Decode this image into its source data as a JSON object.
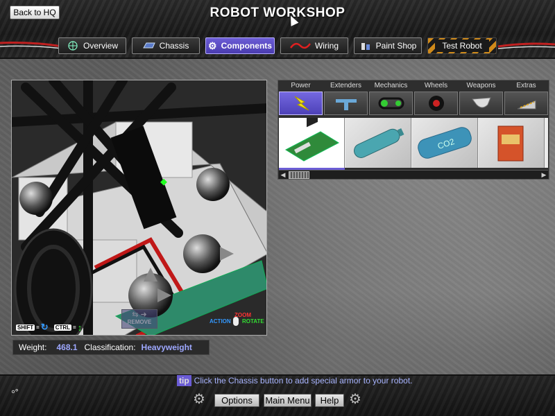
{
  "header": {
    "back_label": "Back to HQ",
    "title": "ROBOT WORKSHOP"
  },
  "tabs": [
    {
      "label": "Overview",
      "icon": "globe-icon"
    },
    {
      "label": "Chassis",
      "icon": "chassis-icon"
    },
    {
      "label": "Components",
      "icon": "gear-icon",
      "active": true
    },
    {
      "label": "Wiring",
      "icon": "wire-icon"
    },
    {
      "label": "Paint Shop",
      "icon": "paint-icon"
    },
    {
      "label": "Test Robot",
      "icon": ""
    }
  ],
  "viewport": {
    "shift_key": "SHIFT",
    "ctrl_key": "CTRL",
    "remove_label": "REMOVE",
    "zoom_label": "ZOOM",
    "action_label": "ACTION",
    "rotate_label": "ROTATE"
  },
  "stats": {
    "weight_label": "Weight:",
    "weight_value": "468.1",
    "class_label": "Classification:",
    "class_value": "Heavyweight"
  },
  "categories": [
    {
      "label": "Power",
      "icon": "lightning-icon",
      "active": true
    },
    {
      "label": "Extenders",
      "icon": "extender-icon"
    },
    {
      "label": "Mechanics",
      "icon": "belt-icon"
    },
    {
      "label": "Wheels",
      "icon": "wheel-icon"
    },
    {
      "label": "Weapons",
      "icon": "blade-icon"
    },
    {
      "label": "Extras",
      "icon": "wedge-icon"
    }
  ],
  "items": [
    {
      "name": "circuit-board-item",
      "icon": "circuit-board-icon",
      "selected": true
    },
    {
      "name": "battery-cylinder-item",
      "icon": "battery-icon"
    },
    {
      "name": "co2-tank-item",
      "icon": "co2-tank-icon",
      "text": "CO2"
    },
    {
      "name": "power-box-item",
      "icon": "power-box-icon"
    }
  ],
  "tip": {
    "badge": "tip",
    "text": "Click the Chassis button to add special armor to your robot."
  },
  "footer": {
    "options_label": "Options",
    "main_menu_label": "Main Menu",
    "help_label": "Help"
  }
}
